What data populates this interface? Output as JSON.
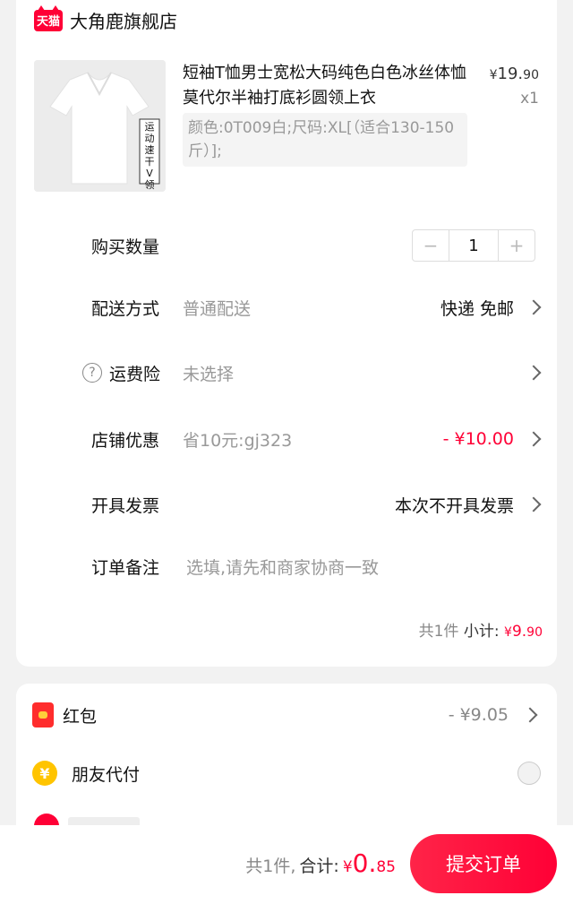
{
  "shop": {
    "badge": "天猫",
    "name": "大角鹿旗舰店"
  },
  "product": {
    "tag": "运动速干V领",
    "title": "短袖T恤男士宽松大码纯色白色冰丝体恤莫代尔半袖打底衫圆领上衣",
    "price_yen": "¥",
    "price_int": "19.",
    "price_dec": "90",
    "qty": "x1",
    "sku": "颜色:0T009白;尺码:XL[（适合130-150斤）];"
  },
  "rows": {
    "quantity_label": "购买数量",
    "quantity_value": "1",
    "minus": "−",
    "plus": "+",
    "delivery_label": "配送方式",
    "delivery_value": "普通配送",
    "delivery_right": "快递 免邮",
    "insurance_icon": "?",
    "insurance_label": "运费险",
    "insurance_value": "未选择",
    "discount_label": "店铺优惠",
    "discount_value": "省10元:gj323",
    "discount_right": "- ¥10.00",
    "invoice_label": "开具发票",
    "invoice_right": "本次不开具发票",
    "note_label": "订单备注",
    "note_placeholder": "选填,请先和商家协商一致"
  },
  "subtotal": {
    "count": "共1件",
    "label": "小计:",
    "yen": "¥",
    "int": "9.",
    "dec": "90"
  },
  "extras": {
    "hongbao_label": "红包",
    "hongbao_value": "- ¥9.05",
    "friend_icon": "¥",
    "friend_label": "朋友代付"
  },
  "bottom": {
    "count": "共1件,",
    "label": "合计:",
    "yen": "¥",
    "int": "0.",
    "dec": "85",
    "submit": "提交订单"
  },
  "colors": {
    "accent": "#ff0036",
    "muted": "#999999"
  }
}
